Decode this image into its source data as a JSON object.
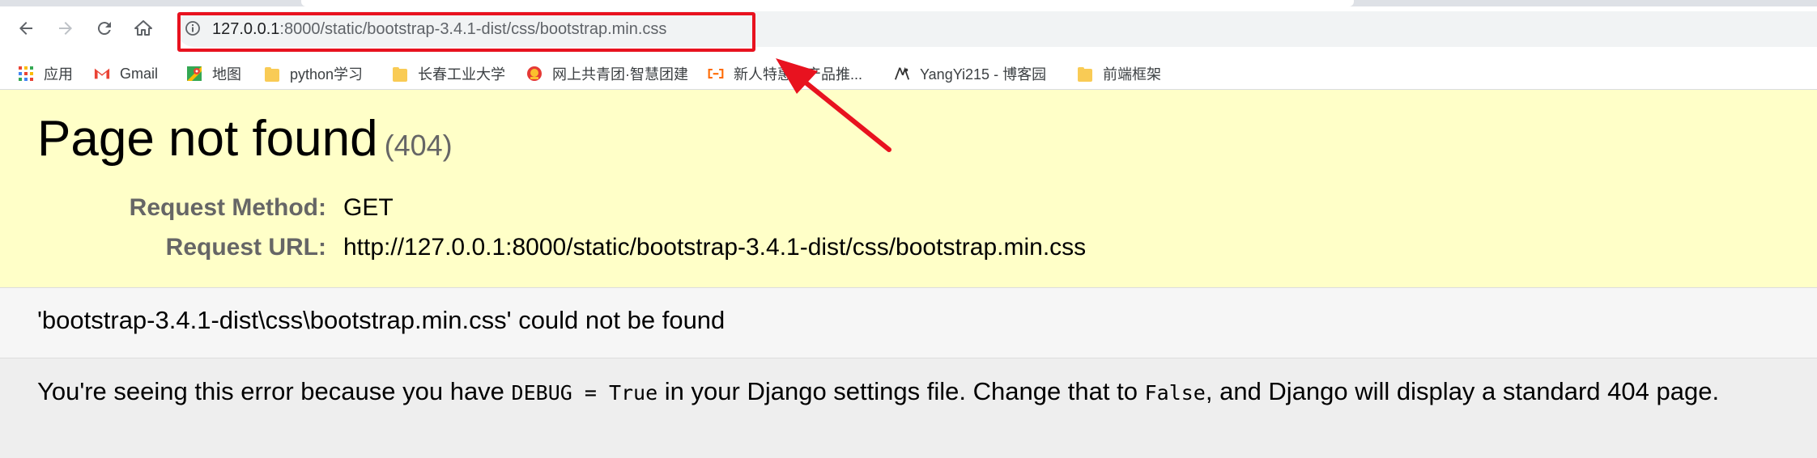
{
  "browser": {
    "url_host": "127.0.0.1",
    "url_rest": ":8000/static/bootstrap-3.4.1-dist/css/bootstrap.min.css"
  },
  "bookmarks": [
    {
      "label": "应用",
      "icon": "apps-grid-icon"
    },
    {
      "label": "Gmail",
      "icon": "gmail-icon"
    },
    {
      "label": "地图",
      "icon": "maps-icon"
    },
    {
      "label": "python学习",
      "icon": "folder-icon"
    },
    {
      "label": "长春工业大学",
      "icon": "folder-icon"
    },
    {
      "label": "网上共青团·智慧团建",
      "icon": "league-emblem-icon"
    },
    {
      "label": "新人特惠云产品推...",
      "icon": "aliyun-icon"
    },
    {
      "label": "YangYi215 - 博客园",
      "icon": "cnblogs-icon"
    },
    {
      "label": "前端框架",
      "icon": "folder-icon"
    }
  ],
  "error_page": {
    "title": "Page not found",
    "status_code": "(404)",
    "request_method_label": "Request Method:",
    "request_method_value": "GET",
    "request_url_label": "Request URL:",
    "request_url_value": "http://127.0.0.1:8000/static/bootstrap-3.4.1-dist/css/bootstrap.min.css",
    "not_found_message": "'bootstrap-3.4.1-dist\\css\\bootstrap.min.css' could not be found",
    "explanation_pre": "You're seeing this error because you have ",
    "explanation_code1": "DEBUG = True",
    "explanation_mid": " in your Django settings file. Change that to ",
    "explanation_code2": "False",
    "explanation_post": ", and Django will display a standard 404 page."
  },
  "colors": {
    "annotation_red": "#e8121f",
    "summary_bg": "#ffffc8"
  }
}
